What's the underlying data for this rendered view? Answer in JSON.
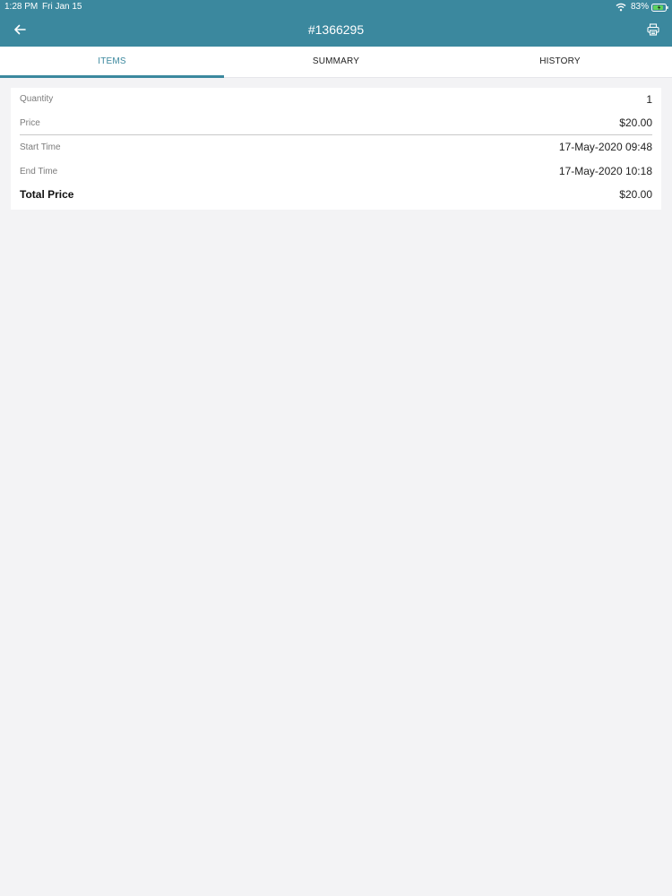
{
  "status_bar": {
    "time": "1:28 PM",
    "date": "Fri Jan 15",
    "battery_percent": "83%",
    "icons": [
      "wifi-icon",
      "battery-charging-icon"
    ]
  },
  "header": {
    "title": "#1366295",
    "back_icon": "arrow-left-icon",
    "print_icon": "printer-icon"
  },
  "tabs": [
    {
      "label": "ITEMS",
      "active": true
    },
    {
      "label": "SUMMARY",
      "active": false
    },
    {
      "label": "HISTORY",
      "active": false
    }
  ],
  "details": {
    "quantity": {
      "label": "Quantity",
      "value": "1"
    },
    "price": {
      "label": "Price",
      "value": "$20.00"
    },
    "start_time": {
      "label": "Start Time",
      "value": "17-May-2020 09:48"
    },
    "end_time": {
      "label": "End Time",
      "value": "17-May-2020 10:18"
    },
    "total_price": {
      "label": "Total Price",
      "value": "$20.00"
    }
  },
  "colors": {
    "accent": "#3b889e",
    "background": "#f3f3f5",
    "card": "#ffffff"
  }
}
